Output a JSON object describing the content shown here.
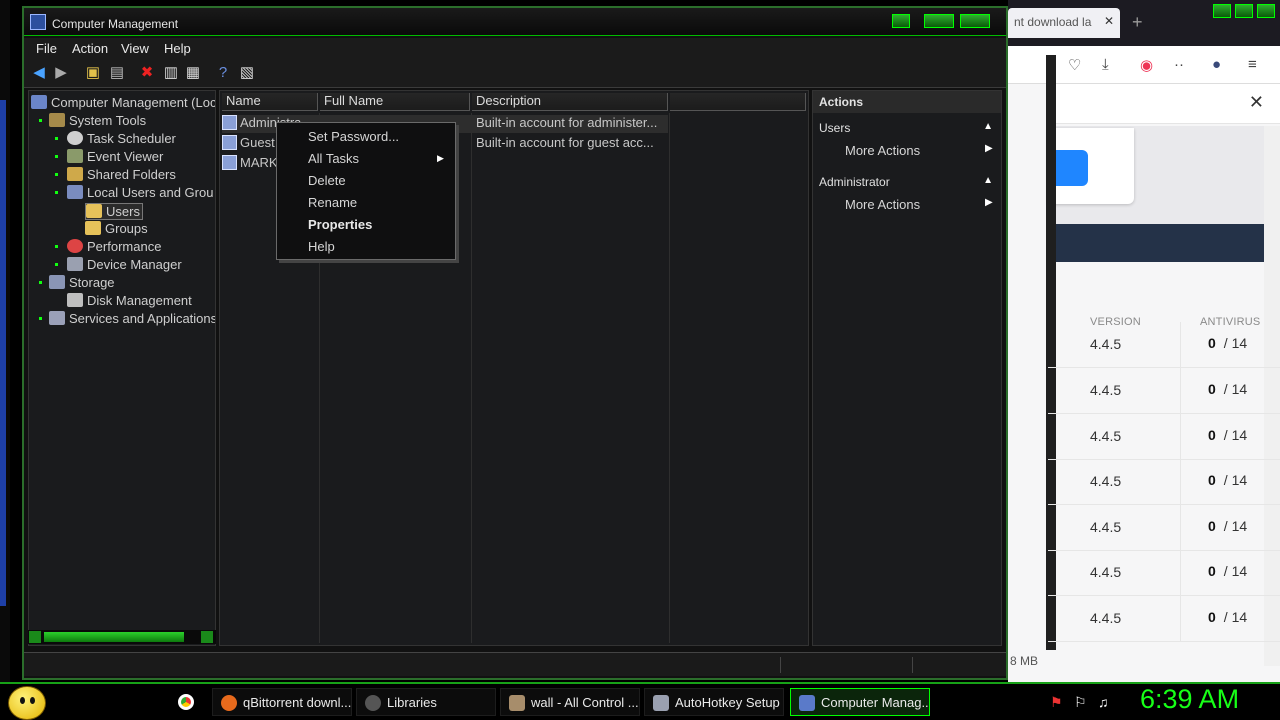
{
  "window": {
    "title": "Computer Management",
    "menu": [
      "File",
      "Action",
      "View",
      "Help"
    ]
  },
  "tree": {
    "root": "Computer Management (Loc",
    "system_tools": "System Tools",
    "task_scheduler": "Task Scheduler",
    "event_viewer": "Event Viewer",
    "shared_folders": "Shared Folders",
    "local_users": "Local Users and Grou",
    "users": "Users",
    "groups": "Groups",
    "performance": "Performance",
    "device_manager": "Device Manager",
    "storage": "Storage",
    "disk_management": "Disk Management",
    "services": "Services and Applications"
  },
  "list": {
    "columns": [
      "Name",
      "Full Name",
      "Description"
    ],
    "rows": [
      {
        "name": "Administra",
        "full_name": "",
        "description": "Built-in account for administer..."
      },
      {
        "name": "Guest",
        "full_name": "",
        "description": "Built-in account for guest acc..."
      },
      {
        "name": "MARK",
        "full_name": "",
        "description": ""
      }
    ]
  },
  "context_menu": {
    "items": [
      "Set Password...",
      "All Tasks",
      "Delete",
      "Rename",
      "Properties",
      "Help"
    ]
  },
  "actions": {
    "header": "Actions",
    "section1": "Users",
    "more1": "More Actions",
    "section2": "Administrator",
    "more2": "More Actions"
  },
  "browser": {
    "tab_title": "nt download la",
    "table": {
      "headers": [
        "VERSION",
        "ANTIVIRUS"
      ],
      "rows": [
        {
          "version": "4.4.5",
          "detections": "0",
          "total": "/ 14"
        },
        {
          "version": "4.4.5",
          "detections": "0",
          "total": "/ 14"
        },
        {
          "version": "4.4.5",
          "detections": "0",
          "total": "/ 14"
        },
        {
          "version": "4.4.5",
          "detections": "0",
          "total": "/ 14"
        },
        {
          "version": "4.4.5",
          "detections": "0",
          "total": "/ 14"
        },
        {
          "version": "4.4.5",
          "detections": "0",
          "total": "/ 14"
        },
        {
          "version": "4.4.5",
          "detections": "0",
          "total": "/ 14"
        }
      ],
      "size_fragment": "8 MB"
    }
  },
  "taskbar": {
    "tasks": [
      "qBittorrent downl...",
      "Libraries",
      "wall - All Control ...",
      "AutoHotkey Setup",
      "Computer Manag..."
    ],
    "clock": "6:39 AM"
  },
  "colors": {
    "accent_green": "#17ff17",
    "window_bg": "#1a1b1d",
    "browser_blue": "#1f86ff"
  }
}
